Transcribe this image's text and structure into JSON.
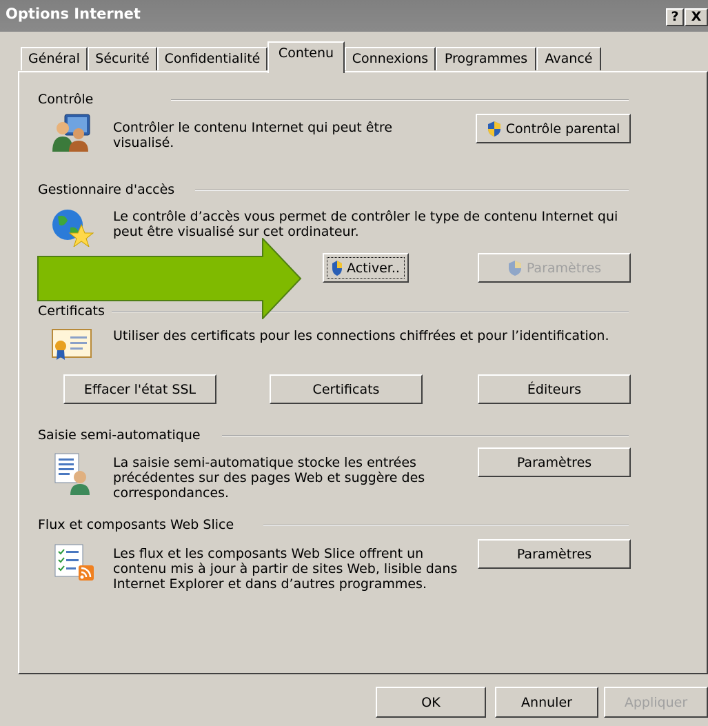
{
  "window": {
    "title": "Options Internet",
    "help_glyph": "?",
    "close_glyph": "X"
  },
  "tabs": [
    {
      "label": "Général"
    },
    {
      "label": "Sécurité"
    },
    {
      "label": "Confidentialité"
    },
    {
      "label": "Contenu",
      "active": true
    },
    {
      "label": "Connexions"
    },
    {
      "label": "Programmes"
    },
    {
      "label": "Avancé"
    }
  ],
  "controle": {
    "heading": "Contrôle",
    "text": "Contrôler le contenu Internet qui peut être visualisé.",
    "button": "Contrôle parental"
  },
  "gestionnaire": {
    "heading": "Gestionnaire d'accès",
    "text": "Le contrôle d’accès vous permet de contrôler le type de contenu Internet qui peut être visualisé sur cet ordinateur.",
    "activate_button": "Activer..",
    "settings_button": "Paramètres"
  },
  "certificats": {
    "heading": "Certificats",
    "text": "Utiliser des certificats pour les connections chiffrées et pour l’identification.",
    "clear_ssl_button": "Effacer l'état SSL",
    "certificates_button": "Certificats",
    "publishers_button": "Éditeurs"
  },
  "saisie": {
    "heading": "Saisie semi-automatique",
    "text_lines": [
      "La saisie semi-automatique stocke les entrées",
      "précédentes sur des pages Web et suggère des",
      "correspondances."
    ],
    "button": "Paramètres"
  },
  "flux": {
    "heading": "Flux et composants Web Slice",
    "text_lines": [
      "Les flux et les composants Web Slice offrent un",
      "contenu mis à jour à partir de sites Web, lisible dans",
      "Internet Explorer et dans d’autres programmes."
    ],
    "button": "Paramètres"
  },
  "footer": {
    "ok": "OK",
    "cancel": "Annuler",
    "apply": "Appliquer"
  },
  "colors": {
    "dialog_bg": "#d4d0c8",
    "titlebar": "#808080",
    "arrow": "#7fba00",
    "arrow_border": "#5a8a1e"
  }
}
